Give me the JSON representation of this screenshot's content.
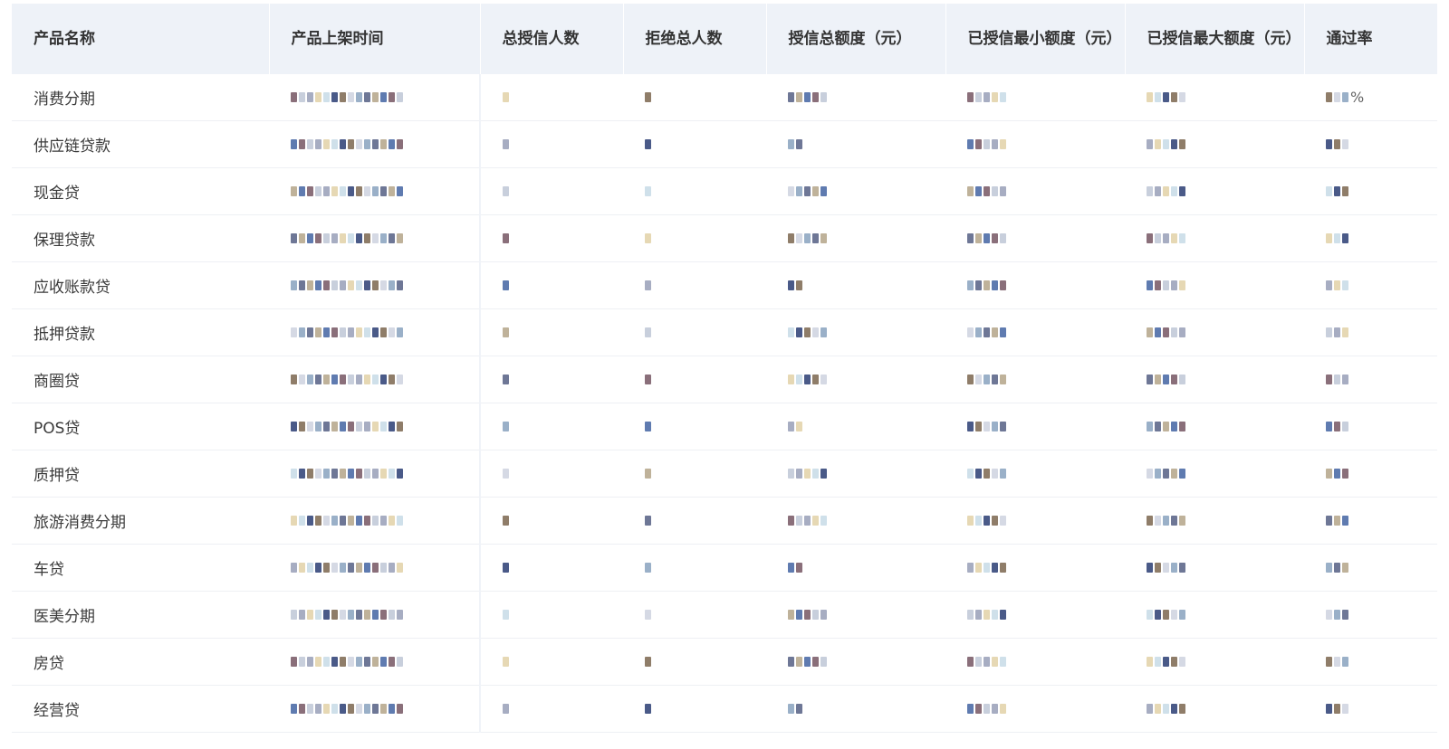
{
  "table": {
    "headers": [
      "产品名称",
      "产品上架时间",
      "总授信人数",
      "拒绝总人数",
      "授信总额度（元）",
      "已授信最小额度（元）",
      "已授信最大额度（元）",
      "通过率"
    ],
    "rows": [
      {
        "product_name": "消费分期"
      },
      {
        "product_name": "供应链贷款"
      },
      {
        "product_name": "现金贷"
      },
      {
        "product_name": "保理贷款"
      },
      {
        "product_name": "应收账款贷"
      },
      {
        "product_name": "抵押贷款"
      },
      {
        "product_name": "商圈贷"
      },
      {
        "product_name": "POS贷"
      },
      {
        "product_name": "质押贷"
      },
      {
        "product_name": "旅游消费分期"
      },
      {
        "product_name": "车贷"
      },
      {
        "product_name": "医美分期"
      },
      {
        "product_name": "房贷"
      },
      {
        "product_name": "经营贷"
      }
    ],
    "percent_sign": "%"
  },
  "colors": {
    "header_bg": "#eef2f8",
    "row_border": "#eef0f4",
    "text": "#333333"
  }
}
